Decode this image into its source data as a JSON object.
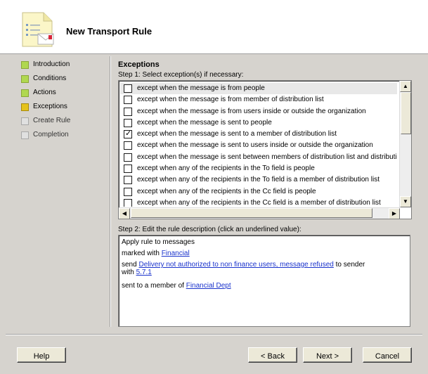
{
  "header": {
    "title": "New Transport Rule",
    "icon": "rule-document-icon"
  },
  "nav": {
    "items": [
      {
        "label": "Introduction",
        "state": "done"
      },
      {
        "label": "Conditions",
        "state": "done"
      },
      {
        "label": "Actions",
        "state": "done"
      },
      {
        "label": "Exceptions",
        "state": "current"
      },
      {
        "label": "Create Rule",
        "state": "pending"
      },
      {
        "label": "Completion",
        "state": "pending"
      }
    ]
  },
  "main": {
    "section_title": "Exceptions",
    "step1_label": "Step 1: Select exception(s) if necessary:",
    "exceptions": [
      {
        "text": "except when the message is from people",
        "checked": false
      },
      {
        "text": "except when the message is from member of distribution list",
        "checked": false
      },
      {
        "text": "except when the message is from users inside or outside the organization",
        "checked": false
      },
      {
        "text": "except when the message is sent to people",
        "checked": false
      },
      {
        "text": "except when the message is sent to a member of distribution list",
        "checked": true
      },
      {
        "text": "except when the message is sent to users inside or outside the organization",
        "checked": false
      },
      {
        "text": "except when the message is sent between members of distribution list and distribution list",
        "checked": false
      },
      {
        "text": "except when any of the recipients in the To field is people",
        "checked": false
      },
      {
        "text": "except when any of the recipients in the To field is a member of distribution list",
        "checked": false
      },
      {
        "text": "except when any of the recipients in the Cc field is people",
        "checked": false
      },
      {
        "text": "except when any of the recipients in the Cc field is a member of distribution list",
        "checked": false
      }
    ],
    "step2_label": "Step 2: Edit the rule description (click an underlined value):",
    "description": {
      "line1": "Apply rule to messages",
      "line2_prefix": "marked with ",
      "line2_link": "Financial",
      "line3_prefix": "send ",
      "line3_link": "Delivery not authorized to non finance users, message refused",
      "line3_suffix": " to sender",
      "line4_prefix": "with ",
      "line4_link": "5.7.1",
      "line5_prefix": "sent to a member of ",
      "line5_link": "Financial Dept"
    }
  },
  "buttons": {
    "help": "Help",
    "back": "< Back",
    "next": "Next >",
    "cancel": "Cancel"
  }
}
